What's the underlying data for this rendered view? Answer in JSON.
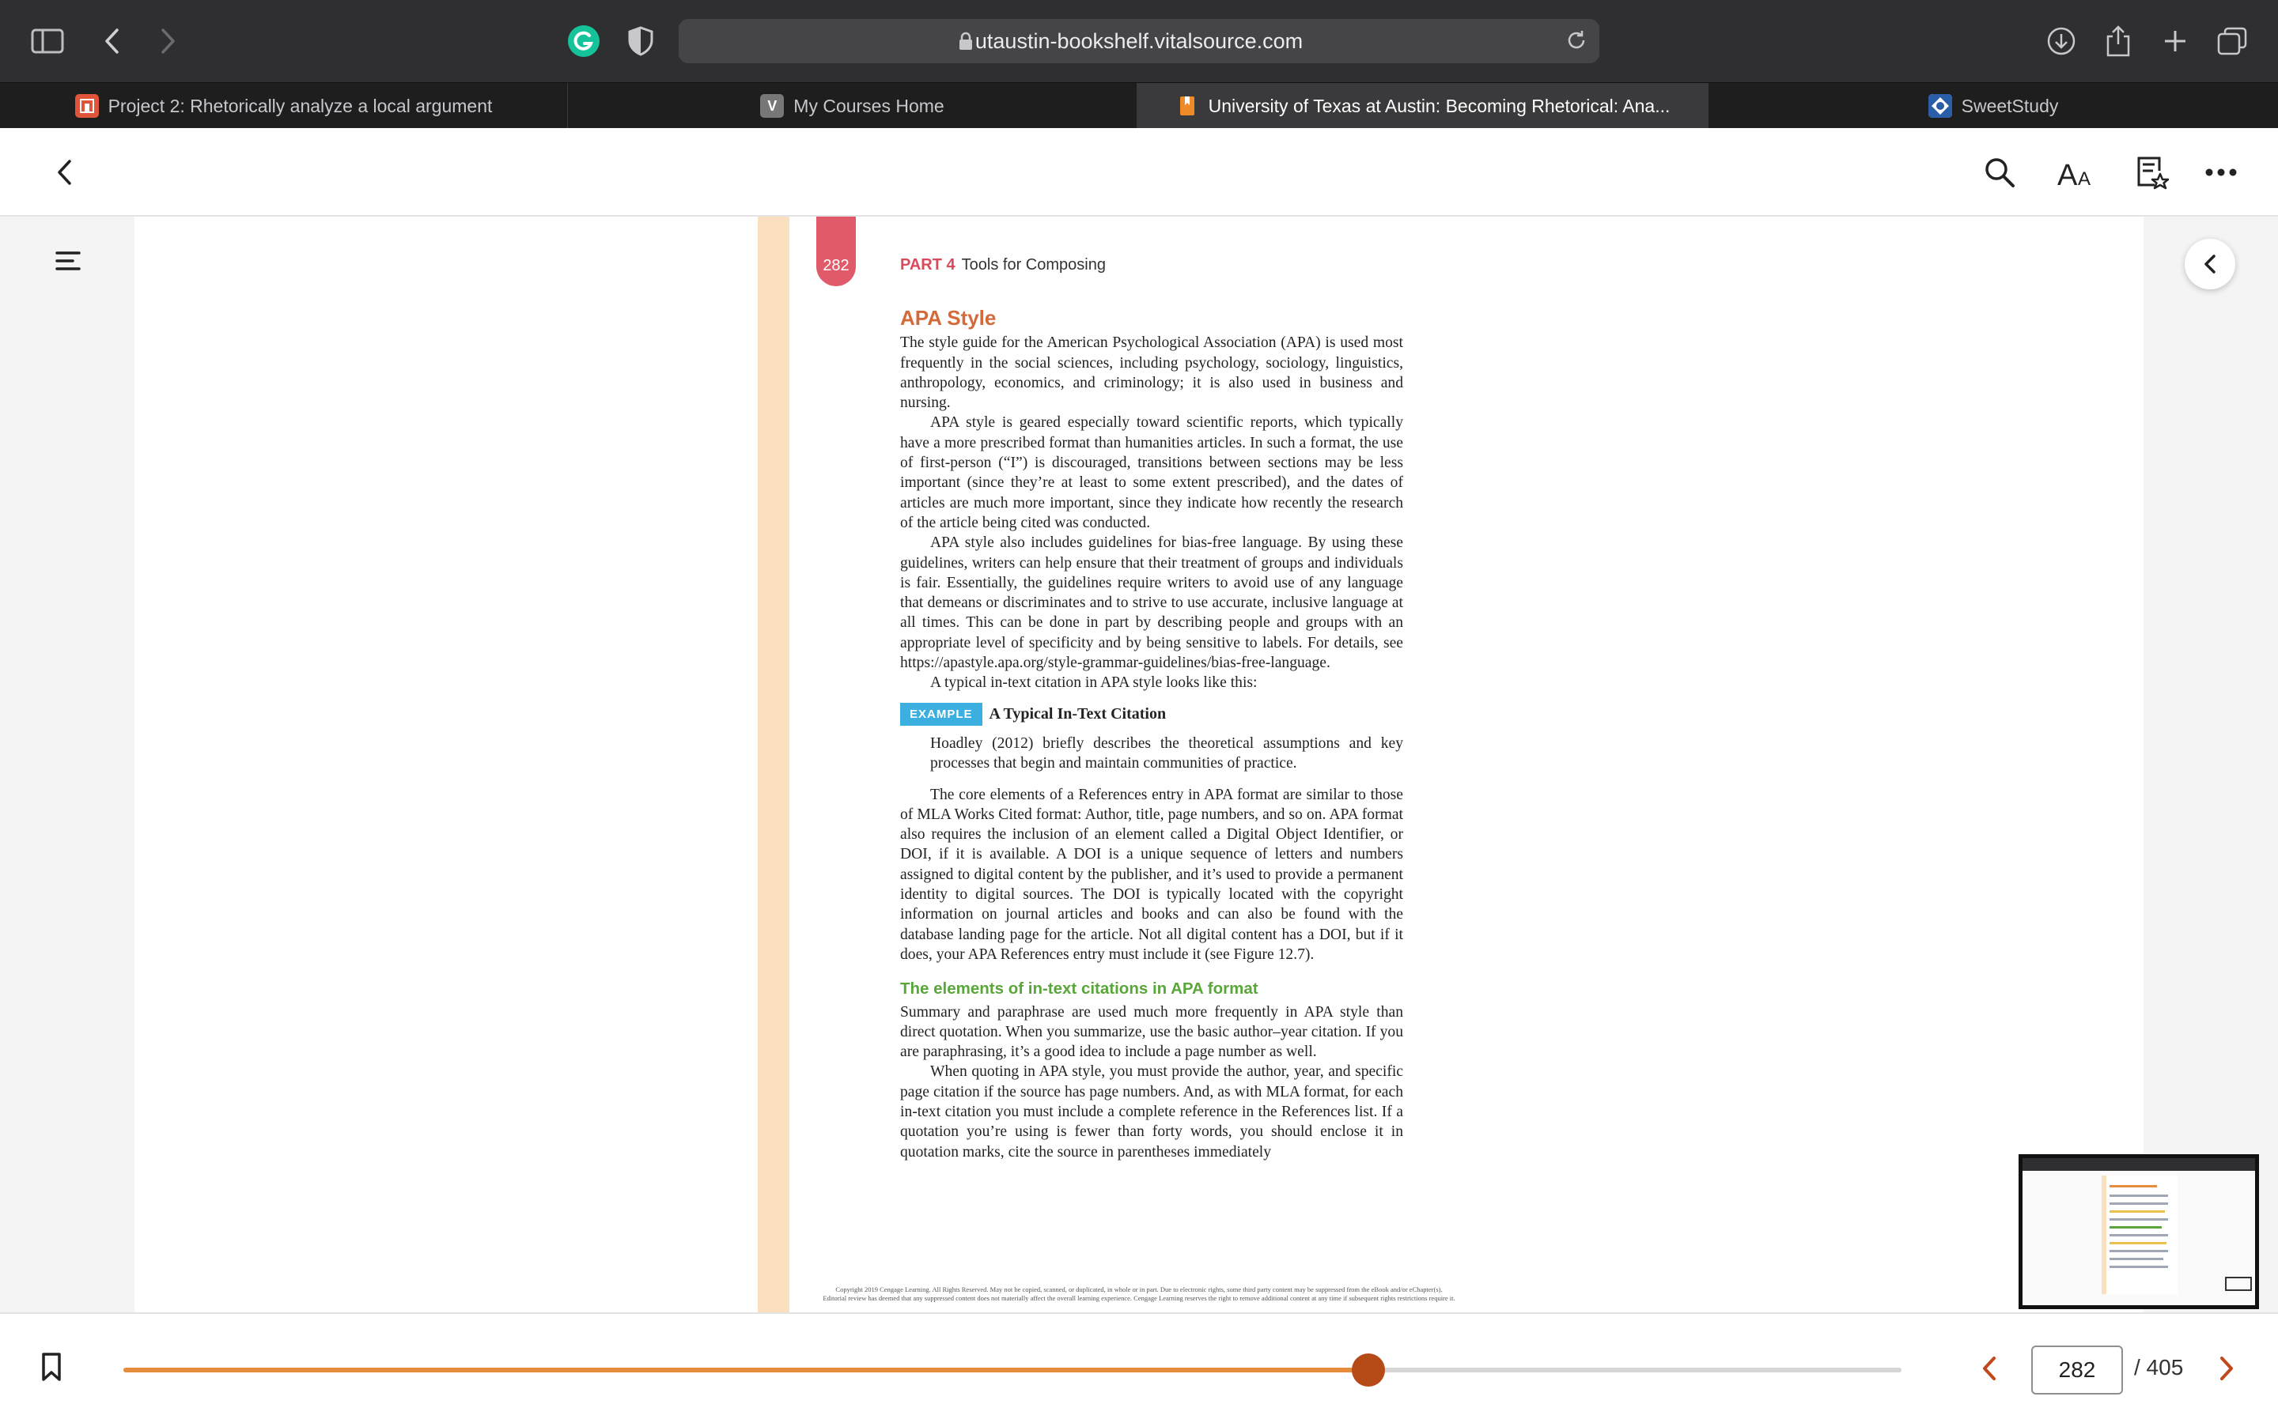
{
  "browser": {
    "url": "utaustin-bookshelf.vitalsource.com",
    "tabs": [
      {
        "label": "Project 2: Rhetorically analyze a local argument",
        "favicon": "canvas-icon",
        "color": "#e0553a"
      },
      {
        "label": "My Courses Home",
        "favicon": "V",
        "color": "#777777"
      },
      {
        "label": "University of Texas at Austin: Becoming Rhetorical: Ana...",
        "favicon": "bookmark-icon",
        "color": "#ee8a28"
      },
      {
        "label": "SweetStudy",
        "favicon": "sweetstudy-icon",
        "color": "#2a5ea8"
      }
    ],
    "active_tab": 2
  },
  "reader": {
    "page_tab_number": "282",
    "running_head_part": "PART 4",
    "running_head_title": "Tools for Composing",
    "heading": "APA Style",
    "p1": "The style guide for the American Psychological Association (APA) is used most frequently in the social sciences, including psychology, sociology, linguistics, anthropology, economics, and criminology; it is also used in business and nursing.",
    "p2": "APA style is geared especially toward scientific reports, which typically have a more prescribed format than humanities articles. In such a format, the use of first-person (“I”) is discouraged, transitions between sections may be less important (since they’re at least to some extent prescribed), and the dates of articles are much more important, since they indicate how recently the research of the article being cited was conducted.",
    "p3": "APA style also includes guidelines for bias-free language. By using these guidelines, writers can help ensure that their treatment of groups and individuals is fair. Essentially, the guidelines require writers to avoid use of any language that demeans or discriminates and to strive to use accurate, inclusive language at all times. This can be done in part by describing people and groups with an appropriate level of specificity and by being sensitive to labels. For details, see https://apastyle.apa.org/style-grammar-guidelines/bias-free-language.",
    "p4": "A typical in-text citation in APA style looks like this:",
    "example_badge": "EXAMPLE",
    "example_title": "A Typical In-Text Citation",
    "example_text": "Hoadley (2012) briefly describes the theoretical assumptions and key processes that begin and maintain communities of practice.",
    "p5": "The core elements of a References entry in APA format are similar to those of MLA Works Cited format: Author, title, page numbers, and so on. APA format also requires the inclusion of an element called a Digital Object Identifier, or DOI, if it is available. A DOI is a unique sequence of letters and numbers assigned to digital content by the publisher, and it’s used to provide a permanent identity to digital sources. The DOI is typically located with the copyright information on journal articles and books and can also be found with the database landing page for the article. Not all digital content has a DOI, but if it does, your APA References entry must include it (see Figure 12.7).",
    "subheading": "The elements of in-text citations in APA format",
    "p6": "Summary and paraphrase are used much more frequently in APA style than direct quotation. When you summarize, use the basic author–year citation. If you are paraphrasing, it’s a good idea to include a page number as well.",
    "p7": "When quoting in APA style, you must provide the author, year, and specific page citation if the source has page numbers. And, as with MLA format, for each in-text citation you must include a complete reference in the References list. If a quotation you’re using is fewer than forty words, you should enclose it in quotation marks, cite the source in parentheses immediately",
    "copyright_1": "Copyright 2019 Cengage Learning. All Rights Reserved. May not be copied, scanned, or duplicated, in whole or in part. Due to electronic rights, some third party content may be suppressed from the eBook and/or eChapter(s).",
    "copyright_2": "Editorial review has deemed that any suppressed content does not materially affect the overall learning experience. Cengage Learning reserves the right to remove additional content at any time if subsequent rights restrictions require it."
  },
  "navigation": {
    "current_page": "282",
    "total_pages": "/ 405",
    "progress_fraction": 0.7
  },
  "colors": {
    "accent": "#e68a3c",
    "thumb": "#b54a16",
    "part_label": "#d94a5c",
    "heading": "#d46a3a",
    "subheading": "#5aa63a",
    "example_badge": "#3bb0e0"
  }
}
